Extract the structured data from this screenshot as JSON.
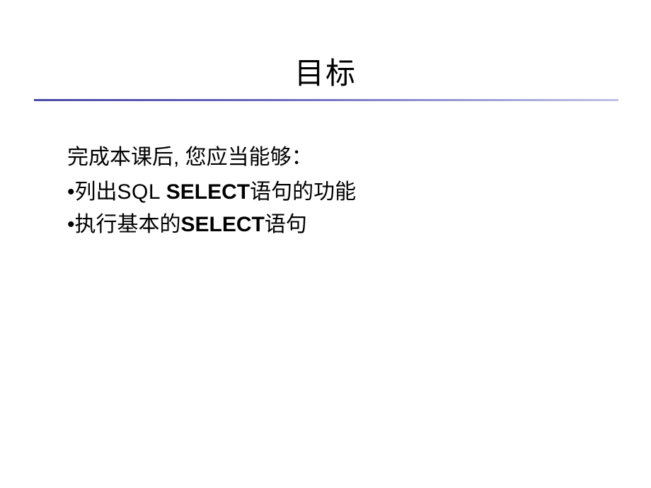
{
  "title": "目标",
  "intro": "完成本课后, 您应当能够：",
  "bullets": [
    {
      "prefix": "•列出",
      "latin1": "SQL ",
      "bold": "SELECT",
      "suffix": "语句的功能"
    },
    {
      "prefix": "•执行基本的",
      "latin1": "",
      "bold": "SELECT",
      "suffix": "语句"
    }
  ]
}
